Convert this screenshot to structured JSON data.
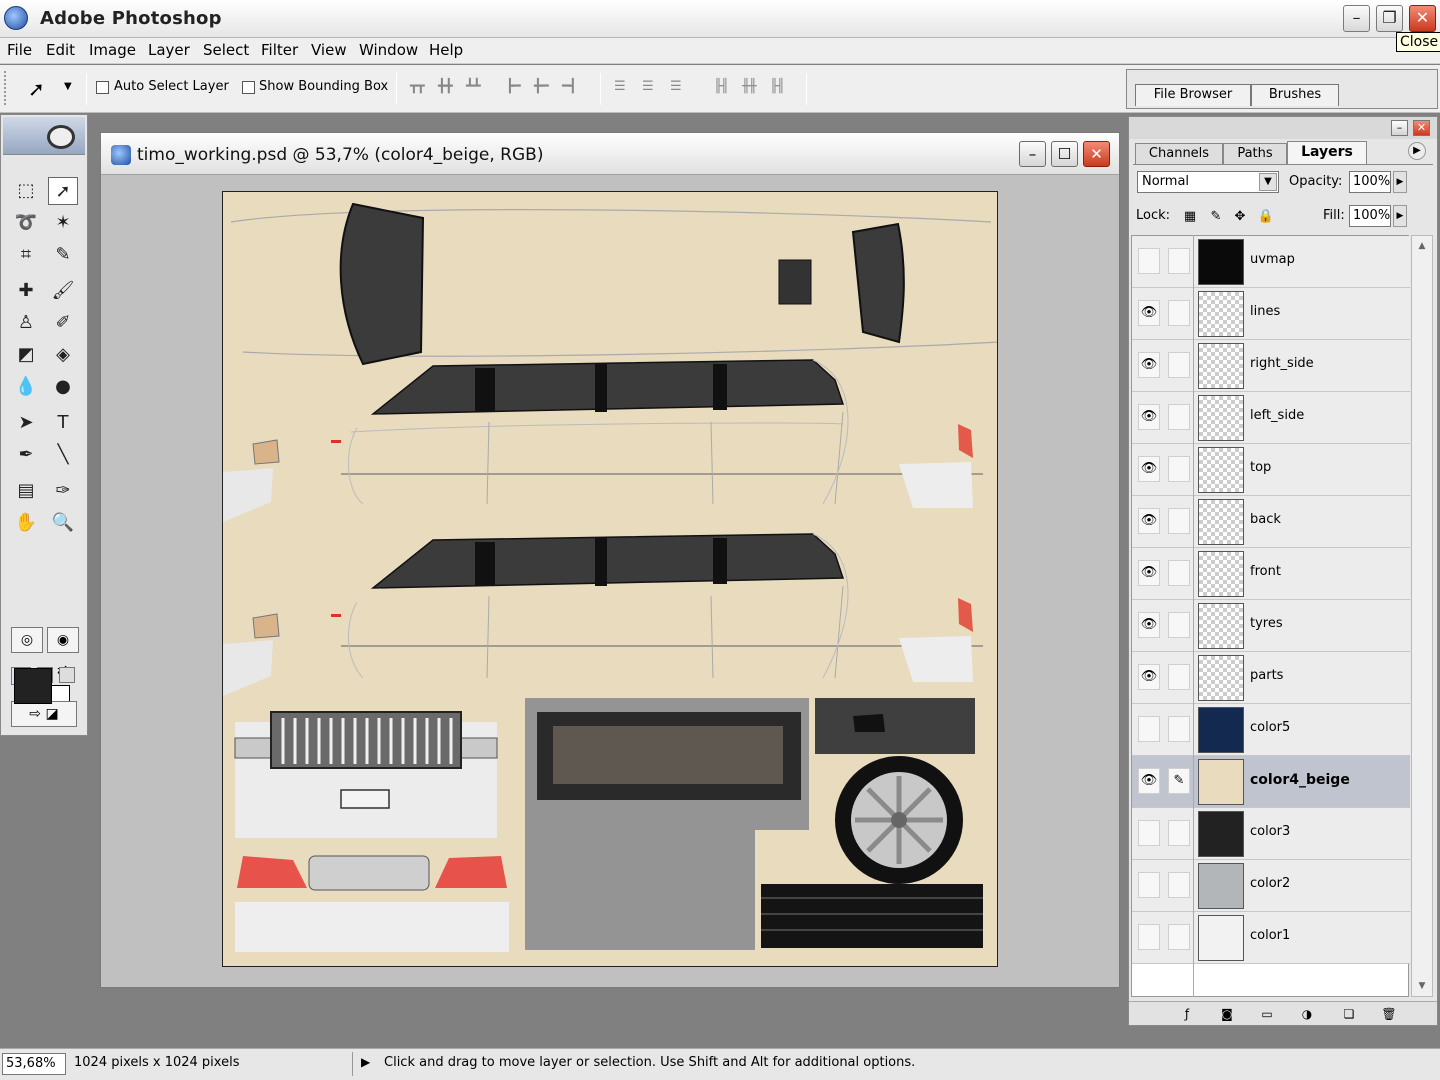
{
  "app": {
    "title": "Adobe Photoshop",
    "tooltip": "Close"
  },
  "menu": [
    "File",
    "Edit",
    "Image",
    "Layer",
    "Select",
    "Filter",
    "View",
    "Window",
    "Help"
  ],
  "options": {
    "auto_select_layer": "Auto Select Layer",
    "show_bounding_box": "Show Bounding Box"
  },
  "palette_well": {
    "tabs": [
      "File Browser",
      "Brushes"
    ]
  },
  "document": {
    "title": "timo_working.psd @ 53,7% (color4_beige, RGB)",
    "background_color": "#e8dbbe"
  },
  "layers_panel": {
    "tabs": [
      "Channels",
      "Paths",
      "Layers"
    ],
    "active_tab": "Layers",
    "blend_mode": "Normal",
    "opacity_label": "Opacity:",
    "opacity": "100%",
    "lock_label": "Lock:",
    "fill_label": "Fill:",
    "fill": "100%",
    "layers": [
      {
        "name": "uvmap",
        "visible": false,
        "thumb": "#0a0a0a"
      },
      {
        "name": "lines",
        "visible": true,
        "thumb": "transparent"
      },
      {
        "name": "right_side",
        "visible": true,
        "thumb": "transparent"
      },
      {
        "name": "left_side",
        "visible": true,
        "thumb": "transparent"
      },
      {
        "name": "top",
        "visible": true,
        "thumb": "transparent"
      },
      {
        "name": "back",
        "visible": true,
        "thumb": "transparent"
      },
      {
        "name": "front",
        "visible": true,
        "thumb": "transparent"
      },
      {
        "name": "tyres",
        "visible": true,
        "thumb": "transparent"
      },
      {
        "name": "parts",
        "visible": true,
        "thumb": "transparent"
      },
      {
        "name": "color5",
        "visible": false,
        "thumb": "#13294f"
      },
      {
        "name": "color4_beige",
        "visible": true,
        "thumb": "#e8dbbe",
        "active": true
      },
      {
        "name": "color3",
        "visible": false,
        "thumb": "#222222"
      },
      {
        "name": "color2",
        "visible": false,
        "thumb": "#b3b6b8"
      },
      {
        "name": "color1",
        "visible": false,
        "thumb": "#f2f2f2"
      }
    ]
  },
  "status": {
    "zoom": "53,68%",
    "doc_size": "1024 pixels x 1024 pixels",
    "hint": "Click and drag to move layer or selection.  Use Shift and Alt for additional options."
  },
  "icons": {
    "visible": "eye-icon",
    "brush": "brush-icon"
  }
}
